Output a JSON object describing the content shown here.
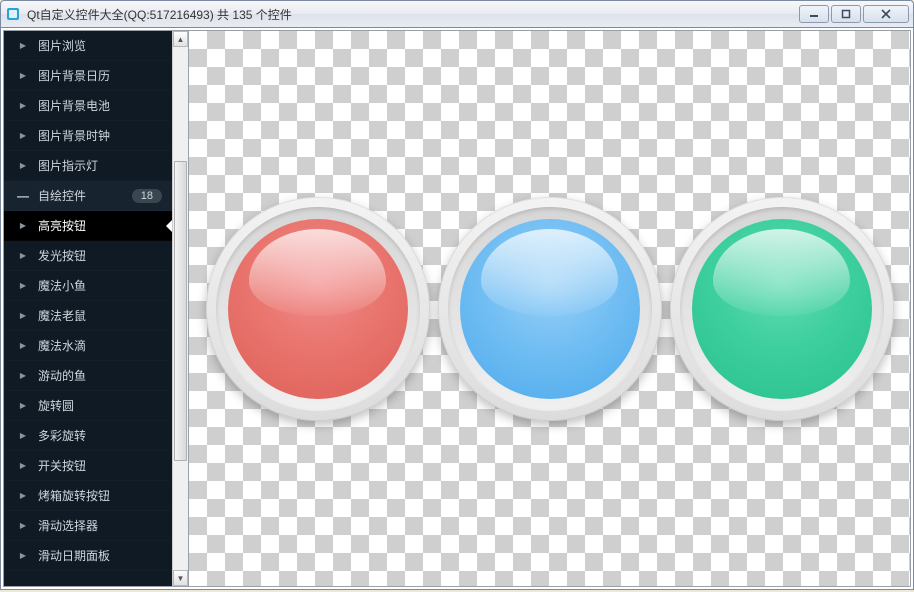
{
  "window": {
    "title": "Qt自定义控件大全(QQ:517216493) 共 135 个控件"
  },
  "sidebar": {
    "items": [
      {
        "label": "图片浏览",
        "type": "sub"
      },
      {
        "label": "图片背景日历",
        "type": "sub"
      },
      {
        "label": "图片背景电池",
        "type": "sub"
      },
      {
        "label": "图片背景时钟",
        "type": "sub"
      },
      {
        "label": "图片指示灯",
        "type": "sub"
      },
      {
        "label": "自绘控件",
        "type": "category",
        "badge": "18"
      },
      {
        "label": "高亮按钮",
        "type": "sub",
        "selected": true
      },
      {
        "label": "发光按钮",
        "type": "sub"
      },
      {
        "label": "魔法小鱼",
        "type": "sub"
      },
      {
        "label": "魔法老鼠",
        "type": "sub"
      },
      {
        "label": "魔法水滴",
        "type": "sub"
      },
      {
        "label": "游动的鱼",
        "type": "sub"
      },
      {
        "label": "旋转圆",
        "type": "sub"
      },
      {
        "label": "多彩旋转",
        "type": "sub"
      },
      {
        "label": "开关按钮",
        "type": "sub"
      },
      {
        "label": "烤箱旋转按钮",
        "type": "sub"
      },
      {
        "label": "滑动选择器",
        "type": "sub"
      },
      {
        "label": "滑动日期面板",
        "type": "sub"
      }
    ]
  },
  "content": {
    "demo_name": "高亮按钮",
    "buttons": [
      {
        "color_name": "red",
        "color": "#e46a63"
      },
      {
        "color_name": "blue",
        "color": "#5cb4ef"
      },
      {
        "color_name": "green",
        "color": "#34c997"
      }
    ]
  }
}
